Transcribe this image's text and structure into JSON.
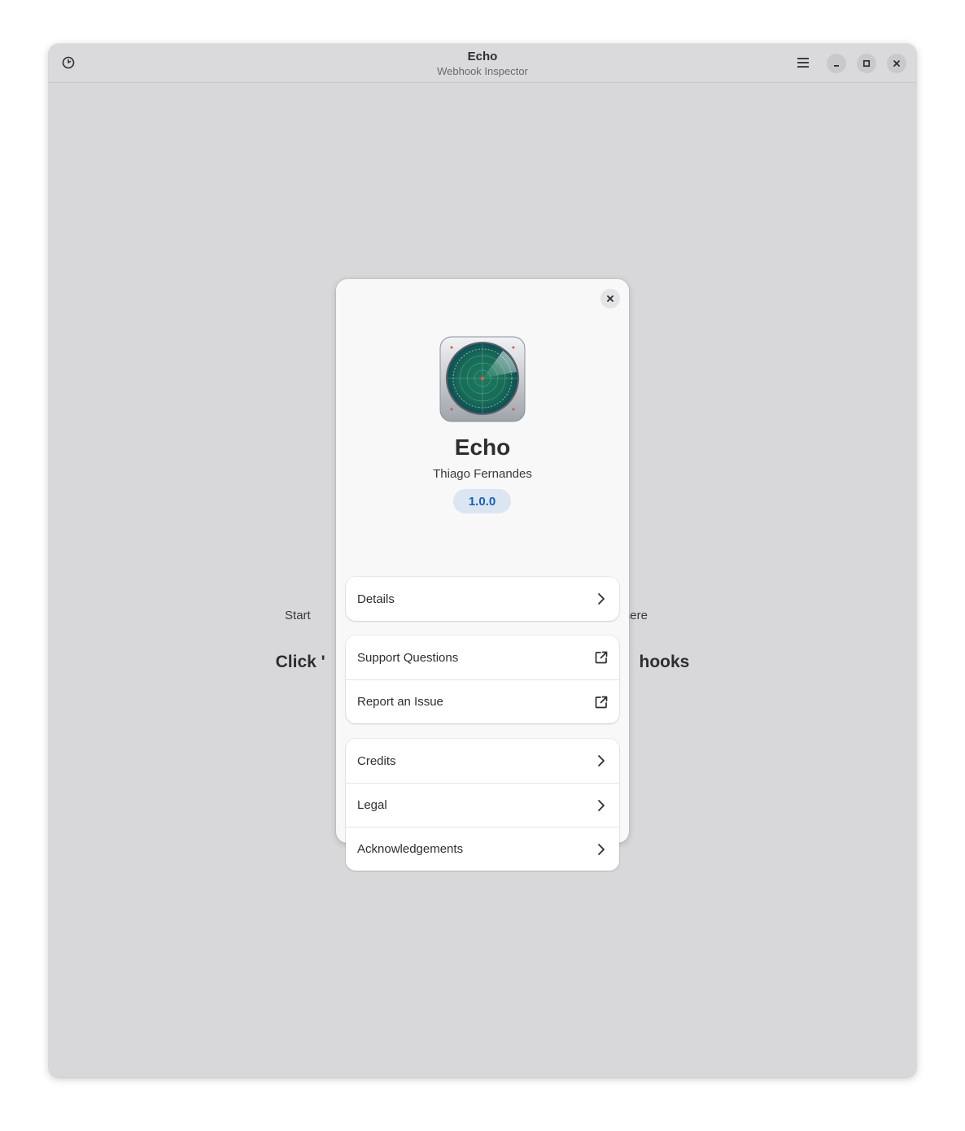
{
  "window": {
    "title": "Echo",
    "subtitle": "Webhook Inspector"
  },
  "titlebar_icons": {
    "history": "history-icon",
    "menu": "menu-icon",
    "minimize": "minimize-icon",
    "maximize": "maximize-icon",
    "close": "close-icon"
  },
  "background": {
    "line1_left": "Start",
    "line1_right": "here",
    "line2_left": "Click '",
    "line2_right": "hooks"
  },
  "about": {
    "app_name": "Echo",
    "developer": "Thiago Fernandes",
    "version": "1.0.0",
    "rows_group1": [
      {
        "label": "Details",
        "icon": "chevron-right-icon"
      }
    ],
    "rows_group2": [
      {
        "label": "Support Questions",
        "icon": "external-link-icon"
      },
      {
        "label": "Report an Issue",
        "icon": "external-link-icon"
      }
    ],
    "rows_group3": [
      {
        "label": "Credits",
        "icon": "chevron-right-icon"
      },
      {
        "label": "Legal",
        "icon": "chevron-right-icon"
      },
      {
        "label": "Acknowledgements",
        "icon": "chevron-right-icon"
      }
    ]
  },
  "colors": {
    "window_bg": "#d8d8da",
    "dialog_bg": "#f8f8f8",
    "version_bg": "#dbe6f2",
    "version_fg": "#1c5fae",
    "radar_green": "#1f6e4f"
  }
}
